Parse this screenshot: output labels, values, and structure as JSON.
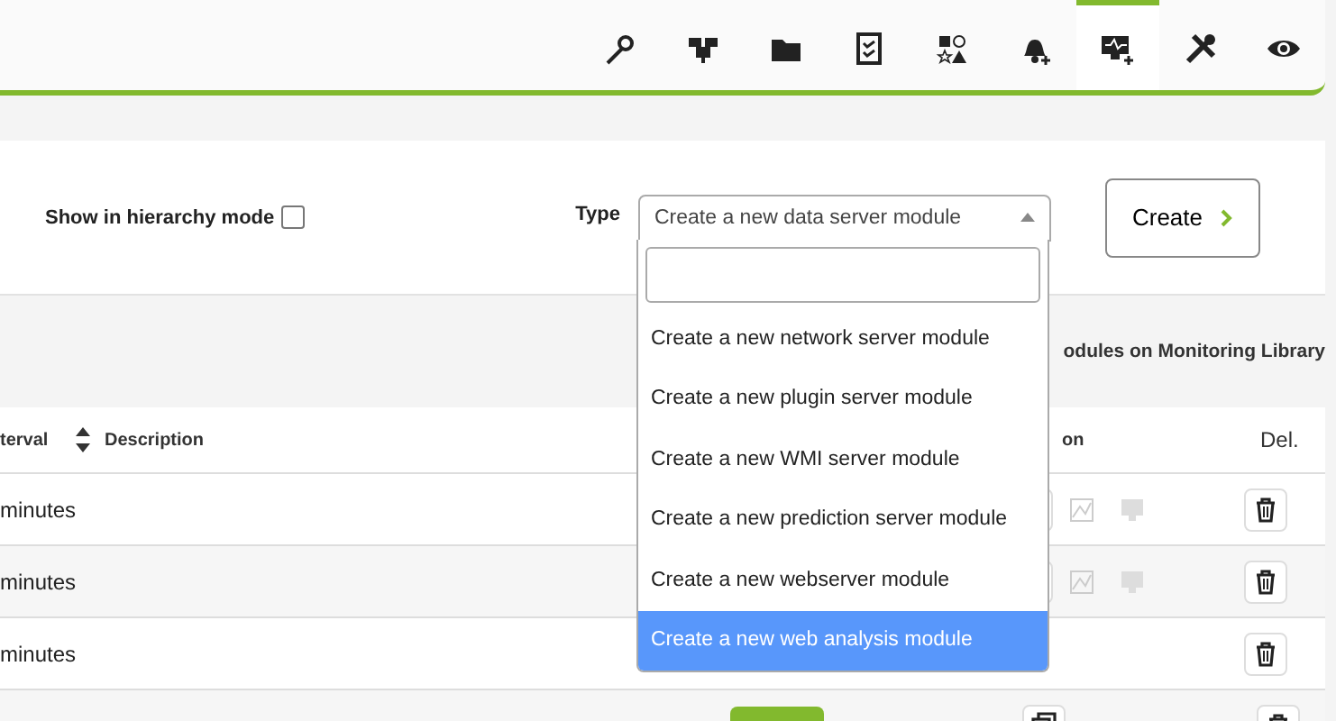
{
  "tabs": [
    {
      "selected": false
    },
    {
      "selected": false
    },
    {
      "selected": false
    },
    {
      "selected": false
    },
    {
      "selected": false
    },
    {
      "selected": false
    },
    {
      "selected": true
    },
    {
      "selected": false
    },
    {
      "selected": false
    }
  ],
  "form": {
    "hierarchy_label": "Show in hierarchy mode",
    "hierarchy_checked": false,
    "type_label": "Type",
    "type_value": "Create a new data server module",
    "expanded": true,
    "options": [
      {
        "label": "Create a new network server module",
        "selected": false
      },
      {
        "label": "Create a new plugin server module",
        "selected": false
      },
      {
        "label": "Create a new WMI server module",
        "selected": false
      },
      {
        "label": "Create a new prediction server module",
        "selected": false
      },
      {
        "label": "Create a new webserver module",
        "selected": false
      },
      {
        "label": "Create a new web analysis module",
        "selected": true
      }
    ],
    "create_button": "Create"
  },
  "library_link": "odules on Monitoring Library",
  "table": {
    "columns": [
      "terval",
      "Description",
      "on",
      "Del."
    ],
    "rows": [
      {
        "interval": "minutes",
        "kind": "full"
      },
      {
        "interval": "minutes",
        "kind": "full"
      },
      {
        "interval": "minutes",
        "kind": "short"
      },
      {
        "kind": "status"
      }
    ]
  }
}
